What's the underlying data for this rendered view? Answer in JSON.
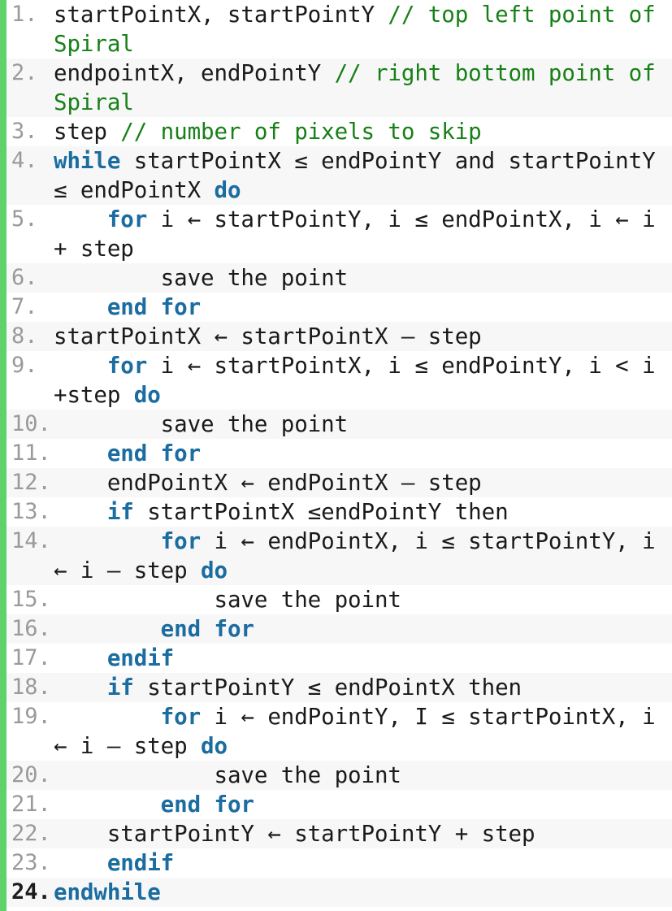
{
  "listing": {
    "language": "pseudocode",
    "accent_stripe_color": "#5FD36A",
    "keyword_color": "#1B6CA0",
    "comment_color": "#178017",
    "plain_color": "#1a1a1a",
    "line_number_color": "#9a9a9a",
    "alt_row_background": "#f7f7f7",
    "row_background": "#ffffff",
    "lines": [
      {
        "number": "1.",
        "text": "startPointX, startPointY // top left point of Spiral",
        "tokens": [
          {
            "t": "startPointX, startPointY ",
            "k": "pl"
          },
          {
            "t": "// top left point of Spiral",
            "k": "cmt"
          }
        ]
      },
      {
        "number": "2.",
        "text": "endpointX, endPointY // right bottom point of Spiral",
        "tokens": [
          {
            "t": "endpointX, endPointY ",
            "k": "pl"
          },
          {
            "t": "// right bottom point of Spiral",
            "k": "cmt"
          }
        ]
      },
      {
        "number": "3.",
        "text": "step // number of pixels to skip",
        "tokens": [
          {
            "t": "step ",
            "k": "pl"
          },
          {
            "t": "// number of pixels to skip",
            "k": "cmt"
          }
        ]
      },
      {
        "number": "4.",
        "text": "while startPointX ≤ endPointY and startPointY ≤ endPointX do",
        "tokens": [
          {
            "t": "while",
            "k": "kw"
          },
          {
            "t": " startPointX ≤ endPointY and startPointY ≤ endPointX ",
            "k": "pl"
          },
          {
            "t": "do",
            "k": "kw"
          }
        ]
      },
      {
        "number": "5.",
        "text": "    for i ← startPointY, i ≤ endPointX, i ← i + step",
        "tokens": [
          {
            "t": "    ",
            "k": "pl"
          },
          {
            "t": "for",
            "k": "kw"
          },
          {
            "t": " i ← startPointY, i ≤ endPointX, i ← i + step",
            "k": "pl"
          }
        ]
      },
      {
        "number": "6.",
        "text": "        save the point",
        "tokens": [
          {
            "t": "        save the point",
            "k": "pl"
          }
        ]
      },
      {
        "number": "7.",
        "text": "    end for",
        "tokens": [
          {
            "t": "    ",
            "k": "pl"
          },
          {
            "t": "end for",
            "k": "kw"
          }
        ]
      },
      {
        "number": "8.",
        "text": "startPointX ← startPointX – step",
        "tokens": [
          {
            "t": "startPointX ← startPointX – step",
            "k": "pl"
          }
        ]
      },
      {
        "number": "9.",
        "text": "    for i ← startPointX, i ≤ endPointY, i < i +step do",
        "tokens": [
          {
            "t": "    ",
            "k": "pl"
          },
          {
            "t": "for",
            "k": "kw"
          },
          {
            "t": " i ← startPointX, i ≤ endPointY, i < i +step ",
            "k": "pl"
          },
          {
            "t": "do",
            "k": "kw"
          }
        ]
      },
      {
        "number": "10.",
        "text": "        save the point",
        "tokens": [
          {
            "t": "        save the point",
            "k": "pl"
          }
        ]
      },
      {
        "number": "11.",
        "text": "    end for",
        "tokens": [
          {
            "t": "    ",
            "k": "pl"
          },
          {
            "t": "end for",
            "k": "kw"
          }
        ]
      },
      {
        "number": "12.",
        "text": "    endPointX ← endPointX – step",
        "tokens": [
          {
            "t": "    endPointX ← endPointX – step",
            "k": "pl"
          }
        ]
      },
      {
        "number": "13.",
        "text": "    if startPointX ≤endPointY then",
        "tokens": [
          {
            "t": "    ",
            "k": "pl"
          },
          {
            "t": "if",
            "k": "kw"
          },
          {
            "t": " startPointX ≤endPointY then",
            "k": "pl"
          }
        ]
      },
      {
        "number": "14.",
        "text": "        for i ← endPointX, i ≤ startPointY, i ← i – step do",
        "tokens": [
          {
            "t": "        ",
            "k": "pl"
          },
          {
            "t": "for",
            "k": "kw"
          },
          {
            "t": " i ← endPointX, i ≤ startPointY, i ← i – step ",
            "k": "pl"
          },
          {
            "t": "do",
            "k": "kw"
          }
        ]
      },
      {
        "number": "15.",
        "text": "            save the point",
        "tokens": [
          {
            "t": "            save the point",
            "k": "pl"
          }
        ]
      },
      {
        "number": "16.",
        "text": "        end for",
        "tokens": [
          {
            "t": "        ",
            "k": "pl"
          },
          {
            "t": "end for",
            "k": "kw"
          }
        ]
      },
      {
        "number": "17.",
        "text": "    endif",
        "tokens": [
          {
            "t": "    ",
            "k": "pl"
          },
          {
            "t": "endif",
            "k": "kw"
          }
        ]
      },
      {
        "number": "18.",
        "text": "    if startPointY ≤ endPointX then",
        "tokens": [
          {
            "t": "    ",
            "k": "pl"
          },
          {
            "t": "if",
            "k": "kw"
          },
          {
            "t": " startPointY ≤ endPointX then",
            "k": "pl"
          }
        ]
      },
      {
        "number": "19.",
        "text": "        for i ← endPointY, I ≤ startPointX, i ← i – step do",
        "tokens": [
          {
            "t": "        ",
            "k": "pl"
          },
          {
            "t": "for",
            "k": "kw"
          },
          {
            "t": " i ← endPointY, I ≤ startPointX, i ← i – step ",
            "k": "pl"
          },
          {
            "t": "do",
            "k": "kw"
          }
        ]
      },
      {
        "number": "20.",
        "text": "            save the point",
        "tokens": [
          {
            "t": "            save the point",
            "k": "pl"
          }
        ]
      },
      {
        "number": "21.",
        "text": "        end for",
        "tokens": [
          {
            "t": "        ",
            "k": "pl"
          },
          {
            "t": "end for",
            "k": "kw"
          }
        ]
      },
      {
        "number": "22.",
        "text": "    startPointY ← startPointY + step",
        "tokens": [
          {
            "t": "    startPointY ← startPointY + step",
            "k": "pl"
          }
        ]
      },
      {
        "number": "23.",
        "text": "    endif",
        "tokens": [
          {
            "t": "    ",
            "k": "pl"
          },
          {
            "t": "endif",
            "k": "kw"
          }
        ]
      },
      {
        "number": "24.",
        "number_emphasis": true,
        "text": "endwhile",
        "tokens": [
          {
            "t": "endwhile",
            "k": "kw"
          }
        ]
      }
    ]
  }
}
